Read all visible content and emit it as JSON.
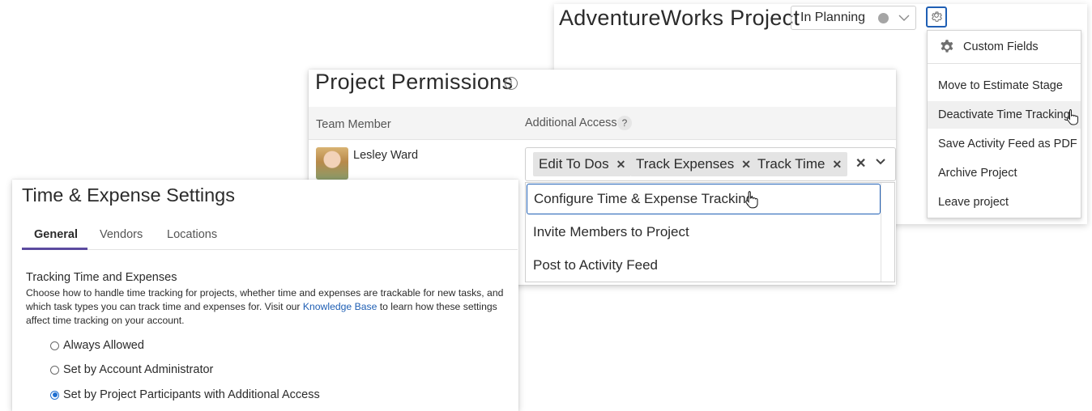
{
  "project": {
    "title": "AdventureWorks Project",
    "status": "In Planning",
    "status_dot_color": "#a5a5a5",
    "gear_menu": {
      "header": "Custom Fields",
      "items": [
        "Move to Estimate Stage",
        "Deactivate Time Tracking",
        "Save Activity Feed as PDF",
        "Archive Project",
        "Leave project"
      ],
      "hovered": "Deactivate Time Tracking"
    }
  },
  "permissions": {
    "title": "Project Permissions",
    "columns": {
      "member": "Team Member",
      "access": "Additional Access",
      "help": "?"
    },
    "member": {
      "name": "Lesley Ward"
    },
    "tags": [
      "Edit To Dos",
      "Track Expenses",
      "Track Time"
    ],
    "clear_symbol": "✕",
    "options": [
      "Configure Time & Expense Tracking",
      "Invite Members to Project",
      "Post to Activity Feed"
    ],
    "focused_option": "Configure Time & Expense Tracking"
  },
  "time_expense": {
    "title": "Time & Expense Settings",
    "tabs": [
      "General",
      "Vendors",
      "Locations"
    ],
    "active_tab": "General",
    "section_heading": "Tracking Time and Expenses",
    "desc_before": "Choose how to handle time tracking for projects, whether time and expenses are trackable for new tasks, and which task types you can track time and expenses for. Visit our ",
    "desc_link": "Knowledge Base",
    "desc_after": " to learn how these settings affect time tracking on your account.",
    "options": [
      "Always Allowed",
      "Set by Account Administrator",
      "Set by Project Participants with Additional Access"
    ],
    "selected": "Set by Project Participants with Additional Access"
  },
  "colors": {
    "accent_blue": "#1f5fb4",
    "tab_underline": "#5b4a9f",
    "radio_selected": "#1f6fd1"
  }
}
